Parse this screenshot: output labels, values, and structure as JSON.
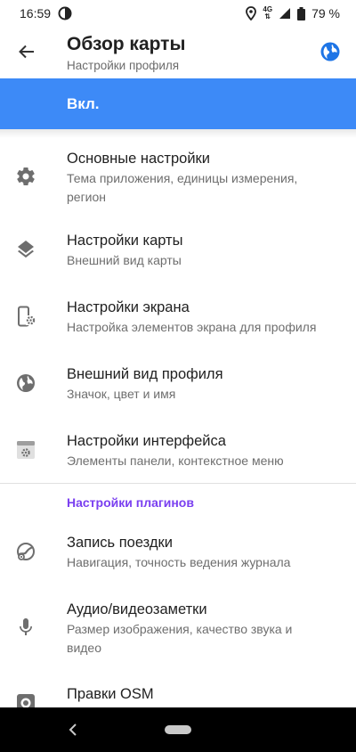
{
  "status": {
    "time": "16:59",
    "network": "4G",
    "battery": "79 %"
  },
  "appbar": {
    "title": "Обзор карты",
    "subtitle": "Настройки профиля",
    "back_icon": "arrow-back-icon",
    "profile_icon": "globe-icon"
  },
  "toggle": {
    "label": "Вкл.",
    "color": "#3d8af7"
  },
  "items": [
    {
      "title": "Основные настройки",
      "subtitle": "Тема приложения, единицы измерения, регион",
      "icon": "gear-icon"
    },
    {
      "title": "Настройки карты",
      "subtitle": "Внешний вид карты",
      "icon": "layers-icon"
    },
    {
      "title": "Настройки экрана",
      "subtitle": "Настройка элементов экрана для профиля",
      "icon": "phone-settings-icon"
    },
    {
      "title": "Внешний вид профиля",
      "subtitle": "Значок, цвет и имя",
      "icon": "globe-icon"
    },
    {
      "title": "Настройки интерфейса",
      "subtitle": "Элементы панели, контекстное меню",
      "icon": "interface-settings-icon"
    }
  ],
  "plugins": {
    "header": "Настройки плагинов",
    "header_color": "#7a3ff0",
    "items": [
      {
        "title": "Запись поездки",
        "subtitle": "Навигация, точность ведения журнала",
        "icon": "trip-recording-icon"
      },
      {
        "title": "Аудио/видеозаметки",
        "subtitle": "Размер изображения, качество звука и видео",
        "icon": "microphone-icon"
      },
      {
        "title": "Правки OSM",
        "icon": "osm-edit-icon"
      }
    ]
  }
}
